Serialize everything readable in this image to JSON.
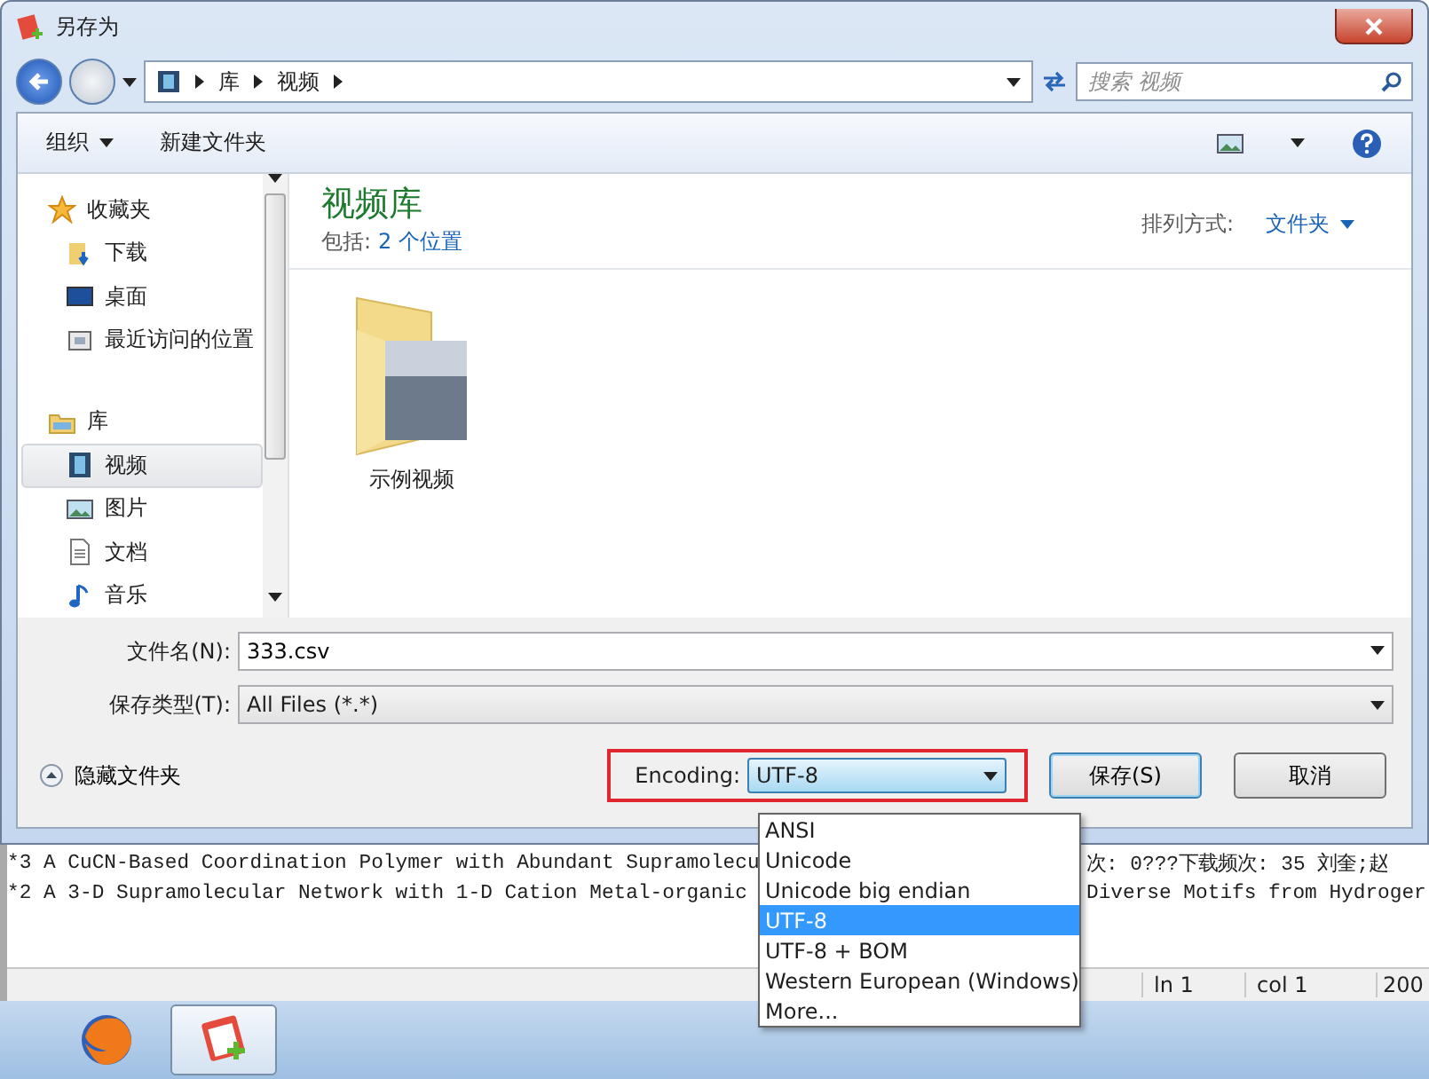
{
  "window": {
    "title": "另存为"
  },
  "address": {
    "path": [
      "库",
      "视频"
    ],
    "search_placeholder": "搜索 视频"
  },
  "toolbar": {
    "organize": "组织",
    "new_folder": "新建文件夹"
  },
  "sidebar": {
    "groups": [
      {
        "label": "收藏夹",
        "kind": "favorites",
        "selected": false,
        "children": [
          {
            "label": "下载",
            "kind": "download",
            "selected": false
          },
          {
            "label": "桌面",
            "kind": "desktop",
            "selected": false
          },
          {
            "label": "最近访问的位置",
            "kind": "recent",
            "selected": false
          }
        ]
      },
      {
        "label": "库",
        "kind": "library",
        "selected": false,
        "children": [
          {
            "label": "视频",
            "kind": "video",
            "selected": true
          },
          {
            "label": "图片",
            "kind": "picture",
            "selected": false
          },
          {
            "label": "文档",
            "kind": "document",
            "selected": false
          },
          {
            "label": "音乐",
            "kind": "music",
            "selected": false
          }
        ]
      }
    ]
  },
  "library": {
    "title": "视频库",
    "includes_label": "包括:",
    "includes_link": "2 个位置",
    "arrange_label": "排列方式:",
    "arrange_value": "文件夹",
    "items": [
      {
        "name": "示例视频"
      }
    ]
  },
  "form": {
    "file_name_label": "文件名(N):",
    "file_name": "333.csv",
    "type_label": "保存类型(T):",
    "type": "All Files (*.*)"
  },
  "footer": {
    "hide_folders": "隐藏文件夹",
    "encoding_label": "Encoding:",
    "encoding": "UTF-8",
    "encoding_open": true,
    "buttons": [
      {
        "label": "保存(S)",
        "default": true
      },
      {
        "label": "取消",
        "default": false
      }
    ]
  },
  "encoding_options": [
    {
      "label": "ANSI",
      "selected": false
    },
    {
      "label": "Unicode",
      "selected": false
    },
    {
      "label": "Unicode big endian",
      "selected": false
    },
    {
      "label": "UTF-8",
      "selected": true
    },
    {
      "label": "UTF-8 + BOM",
      "selected": false
    },
    {
      "label": "Western European (Windows)",
      "selected": false
    },
    {
      "label": "More...",
      "selected": false
    }
  ],
  "editor": {
    "lines": [
      {
        "left": "*3 A CuCN-Based Coordination Polymer with Abundant Supramolecu",
        "right": "次: 0???下载频次: 35 刘奎;赵"
      },
      {
        "left": "*2 A 3-D Supramolecular Network with 1-D Cation Metal-organic",
        "right": "Diverse Motifs from Hydroger"
      }
    ]
  },
  "status_bar": {
    "line": "ln 1",
    "col": "col 1",
    "extra": "200"
  },
  "taskbar": {
    "apps": [
      {
        "kind": "firefox",
        "active": false
      },
      {
        "kind": "notepad",
        "active": true
      }
    ]
  }
}
